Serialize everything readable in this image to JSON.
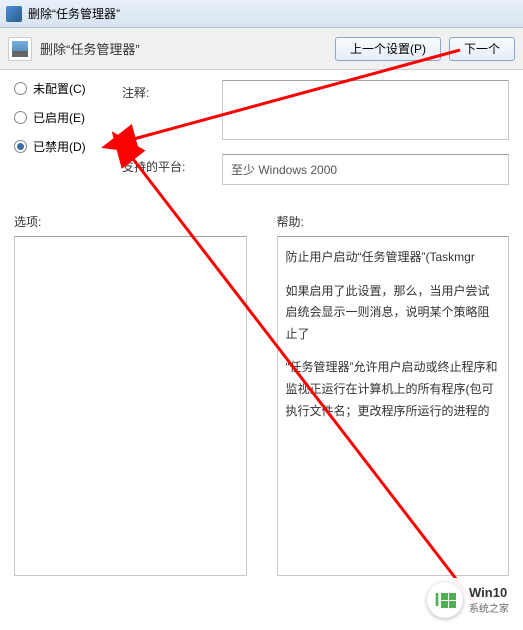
{
  "window": {
    "title": "删除“任务管理器”"
  },
  "toolbar": {
    "title": "删除“任务管理器”",
    "prev_button": "上一个设置(P)",
    "next_button": "下一个"
  },
  "radios": {
    "not_configured": "未配置(C)",
    "enabled": "已启用(E)",
    "disabled": "已禁用(D)",
    "selected": "disabled"
  },
  "fields": {
    "comment_label": "注释:",
    "comment_value": "",
    "platform_label": "支持的平台:",
    "platform_value": "至少 Windows 2000"
  },
  "panels": {
    "options_title": "选项:",
    "help_title": "帮助:",
    "help_paras": [
      "防止用户启动“任务管理器”(Taskmgr",
      "如果启用了此设置，那么，当用户尝试启统会显示一则消息，说明某个策略阻止了",
      "“任务管理器”允许用户启动或终止程序和监视正运行在计算机上的所有程序(包可执行文件名；更改程序所运行的进程的"
    ]
  },
  "watermark": {
    "brand": "Win10",
    "sub": "系统之家"
  }
}
